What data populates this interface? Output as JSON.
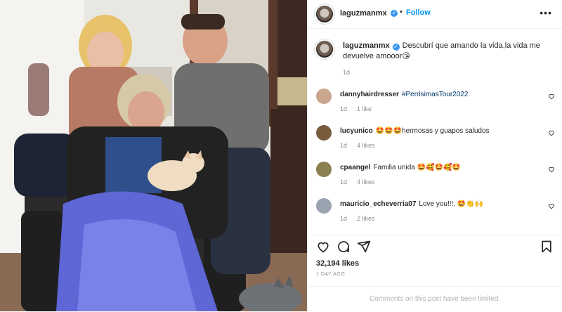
{
  "post": {
    "author": "laguzmanmx",
    "follow_label": "Follow",
    "separator": "•",
    "more_label": "•••",
    "caption": "Descubrí que amando la vida,la vida me devuelve amooor😘",
    "caption_age": "1d",
    "likes": "32,194 likes",
    "posted_when": "1 DAY AGO",
    "comments_limited": "Comments on this post have been limited."
  },
  "comments": [
    {
      "user": "dannyhairdresser",
      "text": "#PerrisimasTour2022",
      "is_link": true,
      "age": "1d",
      "likes": "1 like",
      "avatar_color": "#c9a68d"
    },
    {
      "user": "lucyunico",
      "text": "🤩🤩🤩hermosas y guapos saludos",
      "is_link": false,
      "age": "1d",
      "likes": "4 likes",
      "avatar_color": "#7a5b3c"
    },
    {
      "user": "cpaangel",
      "text": "Familia unida 🤩🥰🤩🥰🤩",
      "is_link": false,
      "age": "1d",
      "likes": "4 likes",
      "avatar_color": "#8a7f4e"
    },
    {
      "user": "mauricio_echeverria07",
      "text": "Love you!!!, 🤩👏🙌",
      "is_link": false,
      "age": "1d",
      "likes": "2 likes",
      "avatar_color": "#9aa3b0"
    }
  ],
  "icons": {
    "like": "heart-icon",
    "comment": "comment-icon",
    "share": "share-icon",
    "save": "bookmark-icon",
    "verified": "verified-icon",
    "more": "more-icon"
  },
  "colors": {
    "accent": "#0095f6",
    "verified": "#3897f0",
    "muted": "#8e8e8e",
    "link": "#00376b"
  }
}
